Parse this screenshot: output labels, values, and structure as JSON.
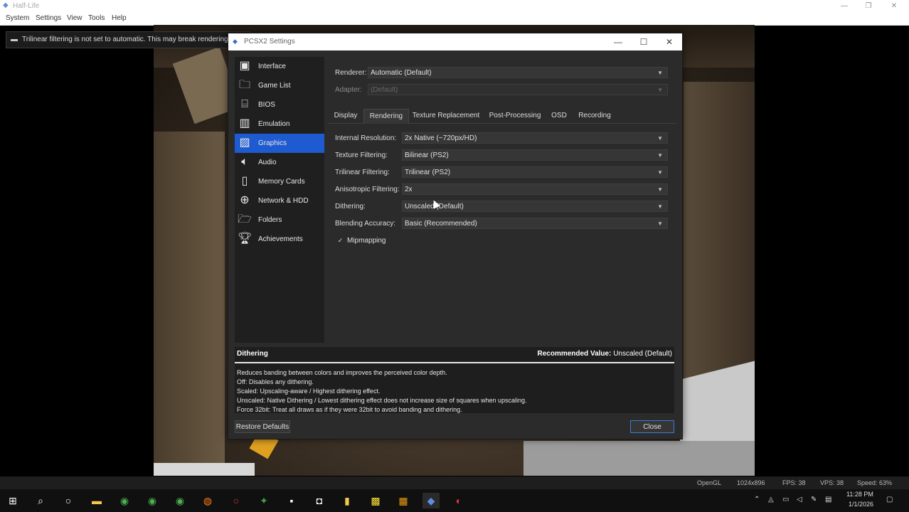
{
  "app": {
    "title": "Half-Life",
    "icon": "pcsx2-icon"
  },
  "menu": [
    "System",
    "Settings",
    "View",
    "Tools",
    "Help"
  ],
  "notification": "Trilinear filtering is not set to automatic. This may break rendering",
  "dialog": {
    "title": "PCSX2 Settings",
    "sidebar": [
      {
        "label": "Interface",
        "icon": "interface-icon"
      },
      {
        "label": "Game List",
        "icon": "folder-icon"
      },
      {
        "label": "BIOS",
        "icon": "chip-icon"
      },
      {
        "label": "Emulation",
        "icon": "emulation-icon"
      },
      {
        "label": "Graphics",
        "icon": "image-icon",
        "selected": true
      },
      {
        "label": "Audio",
        "icon": "speaker-icon"
      },
      {
        "label": "Memory Cards",
        "icon": "memory-card-icon"
      },
      {
        "label": "Network & HDD",
        "icon": "globe-icon"
      },
      {
        "label": "Folders",
        "icon": "folder-settings-icon"
      },
      {
        "label": "Achievements",
        "icon": "trophy-icon"
      }
    ],
    "renderer": {
      "label": "Renderer:",
      "value": "Automatic (Default)"
    },
    "adapter": {
      "label": "Adapter:",
      "value": "(Default)"
    },
    "tabs": [
      "Display",
      "Rendering",
      "Texture Replacement",
      "Post-Processing",
      "OSD",
      "Recording"
    ],
    "selected_tab": "Rendering",
    "settings": [
      {
        "label": "Internal Resolution:",
        "value": "2x Native (~720px/HD)"
      },
      {
        "label": "Texture Filtering:",
        "value": "Bilinear (PS2)"
      },
      {
        "label": "Trilinear Filtering:",
        "value": "Trilinear (PS2)"
      },
      {
        "label": "Anisotropic Filtering:",
        "value": "2x"
      },
      {
        "label": "Dithering:",
        "value": "Unscaled (Default)"
      },
      {
        "label": "Blending Accuracy:",
        "value": "Basic (Recommended)"
      }
    ],
    "mipmapping": {
      "label": "Mipmapping",
      "checked": true
    },
    "description": {
      "heading": "Dithering",
      "recommended_label": "Recommended Value:",
      "recommended_value": "Unscaled (Default)",
      "lines": [
        "Reduces banding between colors and improves the perceived color depth.",
        "Off: Disables any dithering.",
        "Scaled: Upscaling-aware / Highest dithering effect.",
        "Unscaled: Native Dithering / Lowest dithering effect does not increase size of squares when upscaling.",
        "Force 32bit: Treat all draws as if they were 32bit to avoid banding and dithering."
      ]
    },
    "restore_defaults": "Restore Defaults",
    "close": "Close"
  },
  "status": {
    "api": "OpenGL",
    "resolution": "1024x896",
    "fps": "FPS: 38",
    "vps": "VPS: 38",
    "speed": "Speed: 63%"
  },
  "taskbar": {
    "time": "11:28 PM",
    "date": "1/1/2026"
  }
}
